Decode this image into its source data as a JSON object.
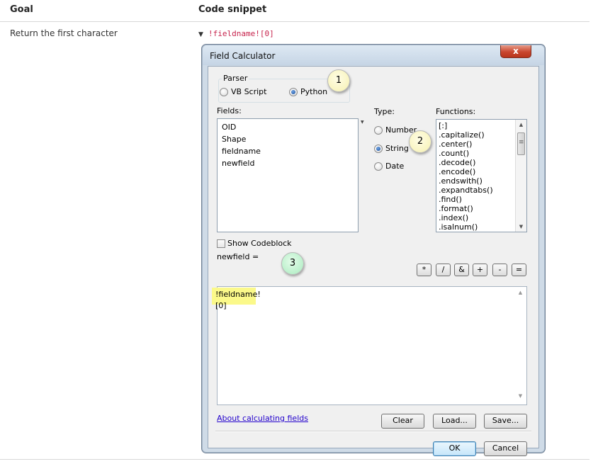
{
  "table": {
    "header_goal": "Goal",
    "header_code": "Code snippet",
    "row_goal": "Return the first character",
    "row_expand_icon": "triangle-down-icon",
    "row_code": "!fieldname![0]"
  },
  "dialog": {
    "title": "Field Calculator",
    "close_label": "x",
    "parser": {
      "label": "Parser",
      "options": [
        "VB Script",
        "Python"
      ],
      "selected": "Python"
    },
    "fields": {
      "label": "Fields:",
      "items": [
        "OID",
        "Shape",
        "fieldname",
        "newfield"
      ]
    },
    "type": {
      "label": "Type:",
      "options": [
        "Number",
        "String",
        "Date"
      ],
      "selected": "String"
    },
    "functions": {
      "label": "Functions:",
      "items": [
        "[:]",
        ".capitalize()",
        ".center()",
        ".count()",
        ".decode()",
        ".encode()",
        ".endswith()",
        ".expandtabs()",
        ".find()",
        ".format()",
        ".index()",
        ".isalnum()"
      ]
    },
    "show_codeblock": {
      "label": "Show Codeblock",
      "checked": false
    },
    "operators": [
      "*",
      "/",
      "&",
      "+",
      "-",
      "="
    ],
    "expression_label": "newfield =",
    "expression_value": "!fieldname![0]",
    "about_link": "About calculating fields",
    "buttons": {
      "clear": "Clear",
      "load": "Load...",
      "save": "Save...",
      "ok": "OK",
      "cancel": "Cancel"
    }
  },
  "annotations": {
    "badge1": "1",
    "badge2": "2",
    "badge3": "3"
  },
  "colors": {
    "highlight": "#fbf98a",
    "code_text": "#c7254e",
    "close_button": "#c9462e",
    "link": "#2200cc"
  }
}
